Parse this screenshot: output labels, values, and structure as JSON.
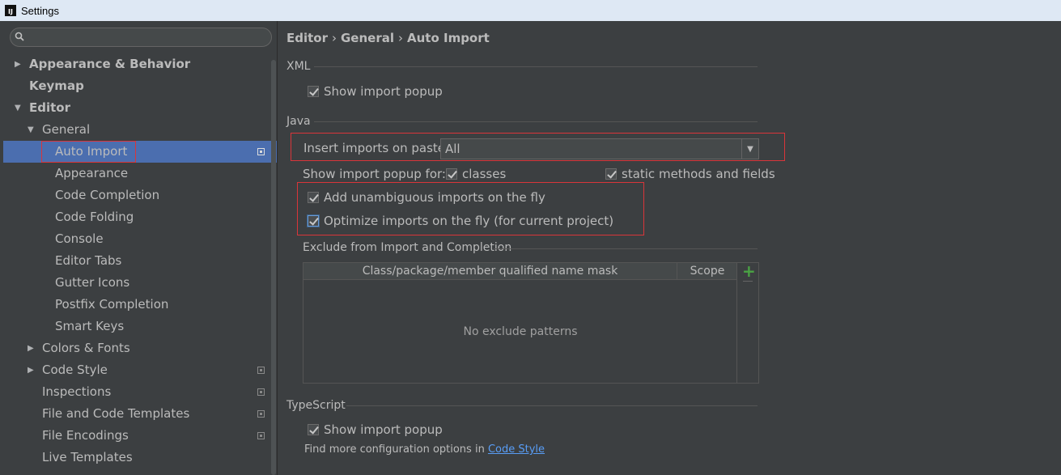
{
  "window": {
    "title": "Settings",
    "icon_text": "IJ"
  },
  "search": {
    "placeholder": ""
  },
  "tree": [
    {
      "label": "Appearance & Behavior",
      "level": 0,
      "arrow": "right",
      "bold": true
    },
    {
      "label": "Keymap",
      "level": 0,
      "arrow": "",
      "bold": true
    },
    {
      "label": "Editor",
      "level": 0,
      "arrow": "down",
      "bold": true
    },
    {
      "label": "General",
      "level": 1,
      "arrow": "down"
    },
    {
      "label": "Auto Import",
      "level": 2,
      "selected": true,
      "project_icon": true
    },
    {
      "label": "Appearance",
      "level": 2
    },
    {
      "label": "Code Completion",
      "level": 2
    },
    {
      "label": "Code Folding",
      "level": 2
    },
    {
      "label": "Console",
      "level": 2
    },
    {
      "label": "Editor Tabs",
      "level": 2
    },
    {
      "label": "Gutter Icons",
      "level": 2
    },
    {
      "label": "Postfix Completion",
      "level": 2
    },
    {
      "label": "Smart Keys",
      "level": 2
    },
    {
      "label": "Colors & Fonts",
      "level": 1,
      "arrow": "right"
    },
    {
      "label": "Code Style",
      "level": 1,
      "arrow": "right",
      "project_icon": true
    },
    {
      "label": "Inspections",
      "level": 1,
      "project_icon": true
    },
    {
      "label": "File and Code Templates",
      "level": 1,
      "project_icon": true
    },
    {
      "label": "File Encodings",
      "level": 1,
      "project_icon": true
    },
    {
      "label": "Live Templates",
      "level": 1
    }
  ],
  "breadcrumb": {
    "part1": "Editor",
    "part2": "General",
    "part3": "Auto Import",
    "sep": "›"
  },
  "xml": {
    "title": "XML",
    "show_import_popup": {
      "label": "Show import popup",
      "checked": true
    }
  },
  "java": {
    "title": "Java",
    "insert_on_paste": {
      "label": "Insert imports on paste:",
      "value": "All"
    },
    "show_popup_for": {
      "label": "Show import popup for:",
      "classes": {
        "label": "classes",
        "checked": true
      },
      "static": {
        "label": "static methods and fields",
        "checked": true
      }
    },
    "add_unambiguous": {
      "label": "Add unambiguous imports on the fly",
      "checked": true
    },
    "optimize_imports": {
      "label": "Optimize imports on the fly (for current project)",
      "checked": true
    },
    "exclude": {
      "title": "Exclude from Import and Completion",
      "columns": [
        "Class/package/member qualified name mask",
        "Scope"
      ],
      "empty_text": "No exclude patterns"
    }
  },
  "typescript": {
    "title": "TypeScript",
    "show_import_popup": {
      "label": "Show import popup",
      "checked": true
    },
    "note_prefix": "Find more configuration options in",
    "note_link": "Code Style"
  }
}
